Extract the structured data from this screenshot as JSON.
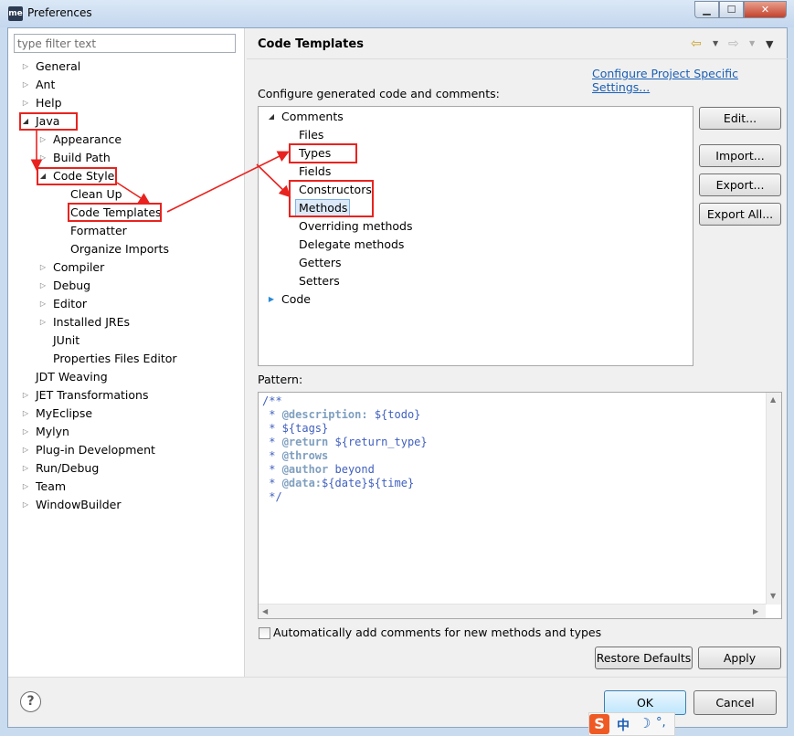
{
  "window": {
    "icon_text": "me",
    "title": "Preferences",
    "minimize_glyph": "▁",
    "maximize_glyph": "☐",
    "close_glyph": "✕"
  },
  "filter": {
    "placeholder": "type filter text"
  },
  "tree": {
    "general": "General",
    "ant": "Ant",
    "help": "Help",
    "java": "Java",
    "appearance": "Appearance",
    "build_path": "Build Path",
    "code_style": "Code Style",
    "clean_up": "Clean Up",
    "code_templates": "Code Templates",
    "formatter": "Formatter",
    "organize_imports": "Organize Imports",
    "compiler": "Compiler",
    "debug": "Debug",
    "editor": "Editor",
    "installed_jres": "Installed JREs",
    "junit": "JUnit",
    "properties_files_editor": "Properties Files Editor",
    "jdt_weaving": "JDT Weaving",
    "jet_transformations": "JET Transformations",
    "myeclipse": "MyEclipse",
    "mylyn": "Mylyn",
    "plugin_development": "Plug-in Development",
    "run_debug": "Run/Debug",
    "team": "Team",
    "windowbuilder": "WindowBuilder"
  },
  "page": {
    "title": "Code Templates",
    "nav_back": "⇦",
    "nav_forward": "⇨",
    "menu": "▼",
    "configure_link": "Configure Project Specific Settings...",
    "configure_label": "Configure generated code and comments:"
  },
  "templates": {
    "comments": "Comments",
    "files": "Files",
    "types": "Types",
    "fields": "Fields",
    "constructors": "Constructors",
    "methods": "Methods",
    "overriding_methods": "Overriding methods",
    "delegate_methods": "Delegate methods",
    "getters": "Getters",
    "setters": "Setters",
    "code": "Code"
  },
  "buttons": {
    "edit": "Edit...",
    "import": "Import...",
    "export": "Export...",
    "export_all": "Export All...",
    "restore_defaults": "Restore Defaults",
    "apply": "Apply",
    "ok": "OK",
    "cancel": "Cancel"
  },
  "pattern": {
    "label": "Pattern:",
    "l1": "/**",
    "l2_pre": " * ",
    "l2_tag": "@description:",
    "l2_val": " ${todo}",
    "l3": " * ${tags}",
    "l4_pre": " * ",
    "l4_tag": "@return",
    "l4_val": " ${return_type}",
    "l5_pre": " * ",
    "l5_tag": "@throws",
    "l6_pre": " * ",
    "l6_tag": "@author",
    "l6_val": " beyond",
    "l7_pre": " * ",
    "l7_tag": "@data:",
    "l7_val": "${date}${time}",
    "l8": " */"
  },
  "checkbox": {
    "label": "Automatically add comments for new methods and types",
    "checked": false
  },
  "help_glyph": "?",
  "ime": {
    "logo": "S",
    "lang": "中",
    "moon": "☽",
    "punct": "°,"
  },
  "colors": {
    "highlight": "#e8231f",
    "link": "#1a5fb4",
    "comment": "#3f5fbf",
    "javadoc_tag": "#7f9fbf"
  }
}
